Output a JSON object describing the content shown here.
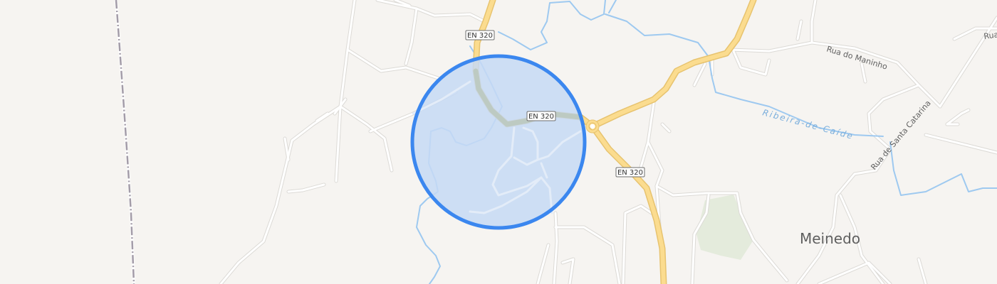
{
  "map": {
    "place_labels": {
      "meinedo": "Meinedo"
    },
    "street_labels": {
      "rua_do_maninho": "Rua do Maninho",
      "rua_de_santa_catarina": "Rua de Santa Catarina",
      "rua_truncated": "Rua"
    },
    "water_labels": {
      "ribeira_de_caide": "Ribeira-de-Caíde"
    },
    "route_shields": {
      "top": "EN 320",
      "middle": "EN 320",
      "lower": "EN 320"
    },
    "colors": {
      "background": "#f6f4f1",
      "minor_road": "#ffffff",
      "major_road": "#fbdc8f",
      "water": "#9ec9f0",
      "park": "#e4ebdc",
      "railway": "#a39ca8",
      "location_circle_fill": "#c6d9f5",
      "location_circle_stroke": "#3b87ef"
    }
  }
}
